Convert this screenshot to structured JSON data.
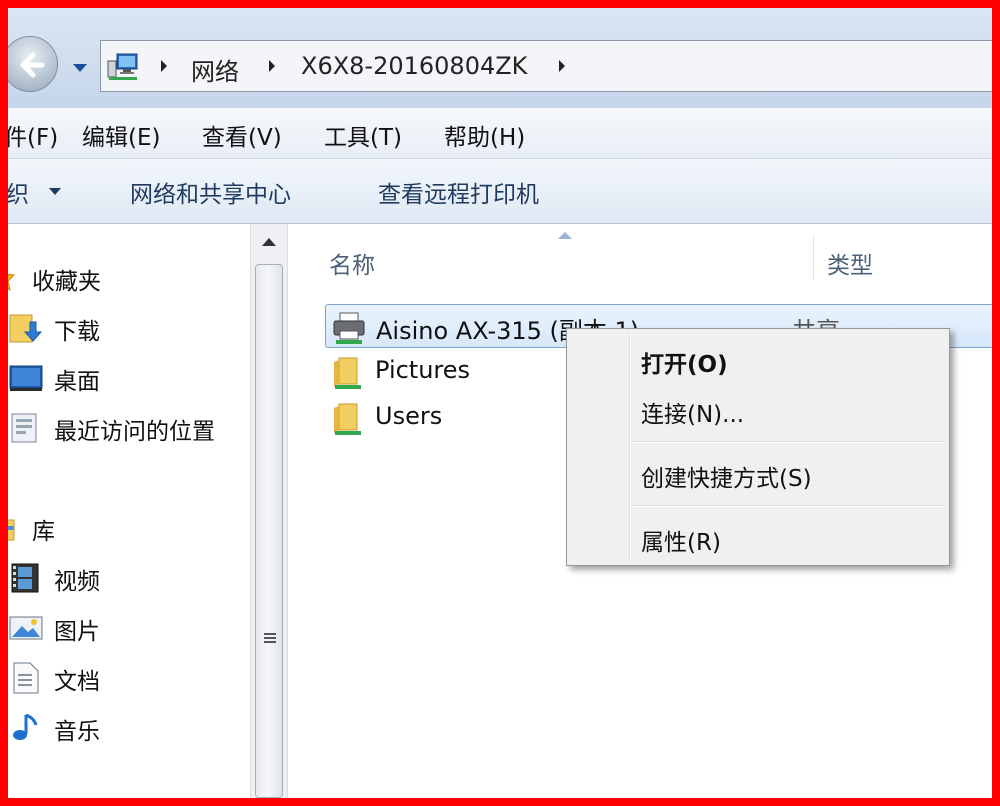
{
  "address": {
    "crumbs": [
      "网络",
      "X6X8-20160804ZK"
    ]
  },
  "menu": {
    "file": "件(F)",
    "edit": "编辑(E)",
    "view": "查看(V)",
    "tools": "工具(T)",
    "help": "帮助(H)"
  },
  "toolbar": {
    "organize": "织",
    "network_center": "网络和共享中心",
    "view_printers": "查看远程打印机"
  },
  "nav": {
    "favorites": "收藏夹",
    "downloads": "下载",
    "desktop": "桌面",
    "recent": "最近访问的位置",
    "libraries": "库",
    "videos": "视频",
    "pictures": "图片",
    "documents": "文档",
    "music": "音乐"
  },
  "columns": {
    "name": "名称",
    "type": "类型"
  },
  "files": [
    {
      "name": "Aisino AX-315 (副本 1)",
      "type": "共享"
    },
    {
      "name": "Pictures",
      "type": ""
    },
    {
      "name": "Users",
      "type": ""
    }
  ],
  "context_menu": {
    "open": "打开(O)",
    "connect": "连接(N)...",
    "shortcut": "创建快捷方式(S)",
    "properties": "属性(R)"
  },
  "colors": {
    "frame": "#ff0000",
    "selection": "#d7e8fb"
  }
}
